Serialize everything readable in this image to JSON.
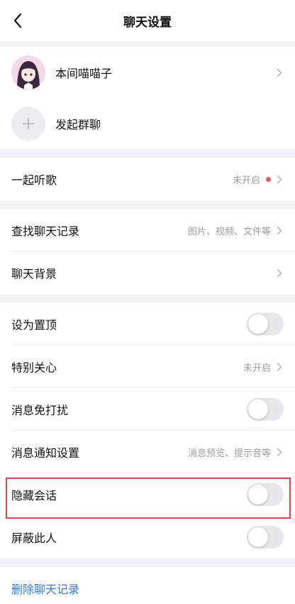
{
  "navbar": {
    "title": "聊天设置"
  },
  "profile": {
    "name": "本间喵喵子"
  },
  "group_chat": {
    "label": "发起群聊"
  },
  "listen_together": {
    "label": "一起听歌",
    "value": "未开启"
  },
  "search_history": {
    "label": "查找聊天记录",
    "value": "图片、视频、文件等"
  },
  "chat_background": {
    "label": "聊天背景"
  },
  "pin_top": {
    "label": "设为置顶",
    "on": false
  },
  "special_care": {
    "label": "特别关心",
    "value": "未开启"
  },
  "do_not_disturb": {
    "label": "消息免打扰",
    "on": false
  },
  "notification_settings": {
    "label": "消息通知设置",
    "value": "消息预览、提示音等"
  },
  "hide_conversation": {
    "label": "隐藏会话",
    "on": false
  },
  "block_person": {
    "label": "屏蔽此人",
    "on": false
  },
  "delete_history": {
    "label": "删除聊天记录"
  },
  "colors": {
    "accent_link": "#2f7ad9",
    "highlight_box": "#e8404a",
    "red_dot": "#f4506b"
  }
}
